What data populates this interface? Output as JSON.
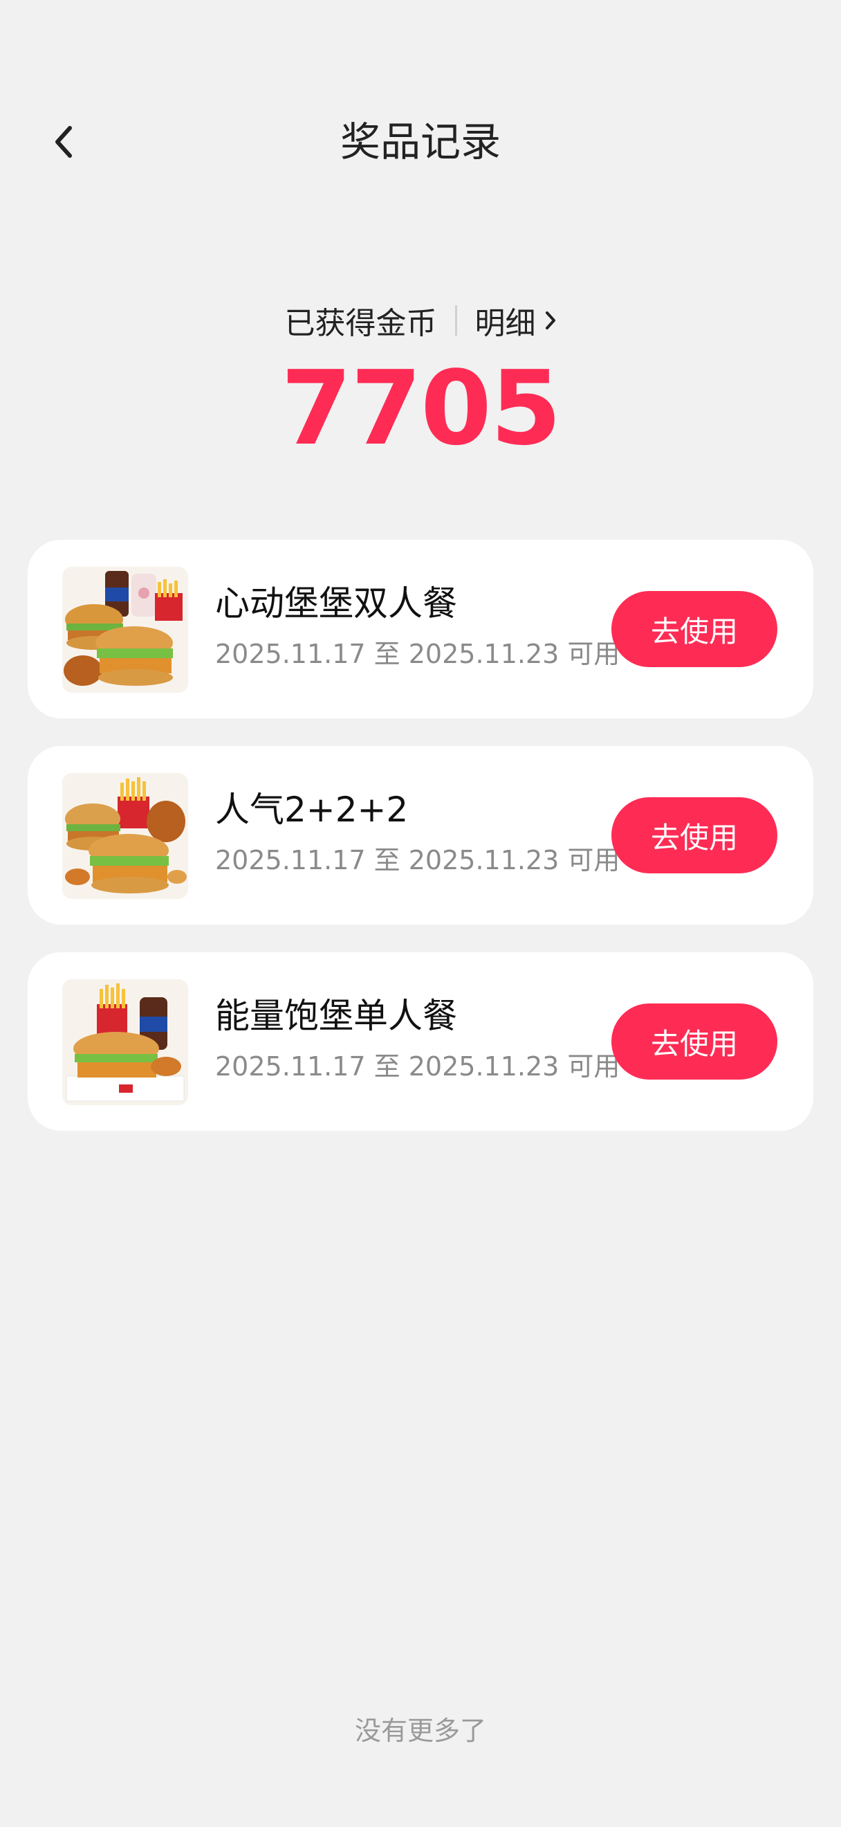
{
  "header": {
    "title": "奖品记录",
    "back_icon": "chevron-left-icon"
  },
  "coins": {
    "label": "已获得金币",
    "detail_label": "明细",
    "value": "7705",
    "accent_color": "#fe2c55"
  },
  "prizes": [
    {
      "name": "心动堡堡双人餐",
      "validity": "2025.11.17 至 2025.11.23 可用",
      "button_label": "去使用",
      "image": "kfc-double-burger-meal"
    },
    {
      "name": "人气2+2+2",
      "validity": "2025.11.17 至 2025.11.23 可用",
      "button_label": "去使用",
      "image": "kfc-popular-combo"
    },
    {
      "name": "能量饱堡单人餐",
      "validity": "2025.11.17 至 2025.11.23 可用",
      "button_label": "去使用",
      "image": "kfc-single-burger-meal"
    }
  ],
  "footer": {
    "note": "没有更多了"
  }
}
